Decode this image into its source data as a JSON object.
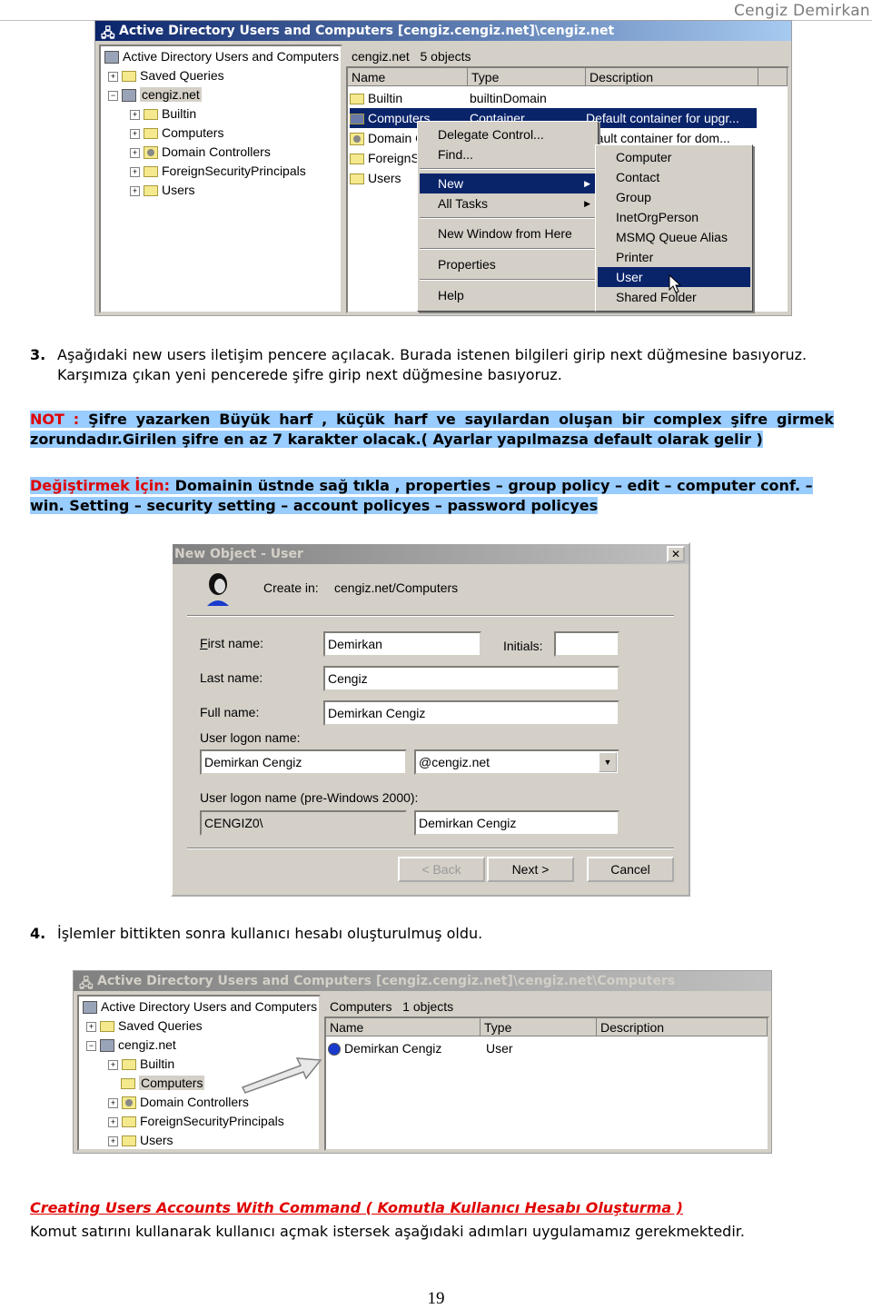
{
  "page_header": {
    "author": "Cengiz Demirkan"
  },
  "screenshot1": {
    "title": "Active Directory Users and Computers [cengiz.cengiz.net]\\cengiz.net",
    "tree_root": "Active Directory Users and Computers",
    "tree": [
      {
        "label": "Saved Queries",
        "icon": "folder-icon",
        "expander": "+"
      },
      {
        "label": "cengiz.net",
        "icon": "domain-icon",
        "expander": "−",
        "selected": true
      },
      {
        "label": "Builtin",
        "icon": "folder-icon",
        "expander": "+"
      },
      {
        "label": "Computers",
        "icon": "folder-icon",
        "expander": "+"
      },
      {
        "label": "Domain Controllers",
        "icon": "domain-controller-icon",
        "expander": "+"
      },
      {
        "label": "ForeignSecurityPrincipals",
        "icon": "folder-icon",
        "expander": "+"
      },
      {
        "label": "Users",
        "icon": "folder-icon",
        "expander": "+"
      }
    ],
    "list_caption": "cengiz.net   5 objects",
    "columns": [
      "Name",
      "Type",
      "Description"
    ],
    "rows": [
      {
        "name": "Builtin",
        "type": "builtinDomain",
        "description": ""
      },
      {
        "name": "Computers",
        "type": "Container",
        "description": "Default container for upgr...",
        "selected": true
      },
      {
        "name": "Domain C",
        "type": "",
        "description": "efault container for dom..."
      },
      {
        "name": "ForeignS",
        "type": "",
        "description": ""
      },
      {
        "name": "Users",
        "type": "",
        "description": ""
      }
    ],
    "context_menu": [
      {
        "label": "Delegate Control...",
        "accel": "e"
      },
      {
        "label": "Find...",
        "accel": "i"
      },
      {
        "sep": true
      },
      {
        "label": "New",
        "accel": "N",
        "submenu": true,
        "highlighted": true
      },
      {
        "label": "All Tasks",
        "accel": "k",
        "submenu": true
      },
      {
        "sep": true
      },
      {
        "label": "New Window from Here",
        "accel": "W"
      },
      {
        "sep": true
      },
      {
        "label": "Properties",
        "accel": "r"
      },
      {
        "sep": true
      },
      {
        "label": "Help",
        "accel": "H"
      }
    ],
    "submenu": [
      "Computer",
      "Contact",
      "Group",
      "InetOrgPerson",
      "MSMQ Queue Alias",
      "Printer",
      "User",
      "Shared Folder"
    ],
    "submenu_highlighted": "User"
  },
  "step3": {
    "number": "3.",
    "text": "Aşağıdaki new users iletişim pencere açılacak. Burada istenen bilgileri girip next düğmesine basıyoruz. Karşımıza çıkan yeni pencerede şifre girip next düğmesine basıyoruz."
  },
  "note": {
    "label": "NOT :",
    "text": " Şifre yazarken Büyük harf , küçük harf ve sayılardan oluşan bir complex şifre girmek zorundadır.Girilen şifre en az 7 karakter olacak.( Ayarlar yapılmazsa default olarak gelir )"
  },
  "change": {
    "label": "Değiştirmek İçin:",
    "text": " Domainin üstnde sağ tıkla , properties – group policy – edit – computer conf. – win. Setting – security setting – account policyes – password policyes"
  },
  "dialog": {
    "title": "New Object - User",
    "close": "✕",
    "create_in_label": "Create in:",
    "create_in_value": "cengiz.net/Computers",
    "first_name_label": "First name:",
    "first_name": "Demirkan",
    "initials_label": "Initials:",
    "initials": "",
    "last_name_label": "Last name:",
    "last_name": "Cengiz",
    "full_name_label": "Full name:",
    "full_name": "Demirkan Cengiz",
    "logon_label": "User logon name:",
    "logon_name": "Demirkan Cengiz",
    "logon_domain": "@cengiz.net",
    "pre2000_label": "User logon name (pre-Windows 2000):",
    "pre2000_domain": "CENGIZ0\\",
    "pre2000_name": "Demirkan Cengiz",
    "back": "< Back",
    "next": "Next >",
    "cancel": "Cancel"
  },
  "step4": {
    "number": "4.",
    "text": "İşlemler bittikten sonra kullanıcı hesabı oluşturulmuş oldu."
  },
  "screenshot2": {
    "title": "Active Directory Users and Computers [cengiz.cengiz.net]\\cengiz.net\\Computers",
    "tree_root": "Active Directory Users and Computers",
    "tree": [
      {
        "label": "Saved Queries",
        "expander": "+"
      },
      {
        "label": "cengiz.net",
        "expander": "−"
      },
      {
        "label": "Builtin",
        "expander": "+"
      },
      {
        "label": "Computers",
        "expander": "",
        "selected": true
      },
      {
        "label": "Domain Controllers",
        "expander": "+"
      },
      {
        "label": "ForeignSecurityPrincipals",
        "expander": "+"
      },
      {
        "label": "Users",
        "expander": "+"
      }
    ],
    "list_caption": "Computers   1 objects",
    "columns": [
      "Name",
      "Type",
      "Description"
    ],
    "rows": [
      {
        "name": "Demirkan Cengiz",
        "type": "User",
        "description": ""
      }
    ]
  },
  "section": {
    "heading": "Creating Users Accounts With Command ( Komutla Kullanıcı Hesabı Oluşturma )",
    "text": "Komut satırını kullanarak kullanıcı açmak istersek aşağıdaki adımları uygulamamız gerekmektedir."
  },
  "footer": {
    "page_number": "19"
  }
}
